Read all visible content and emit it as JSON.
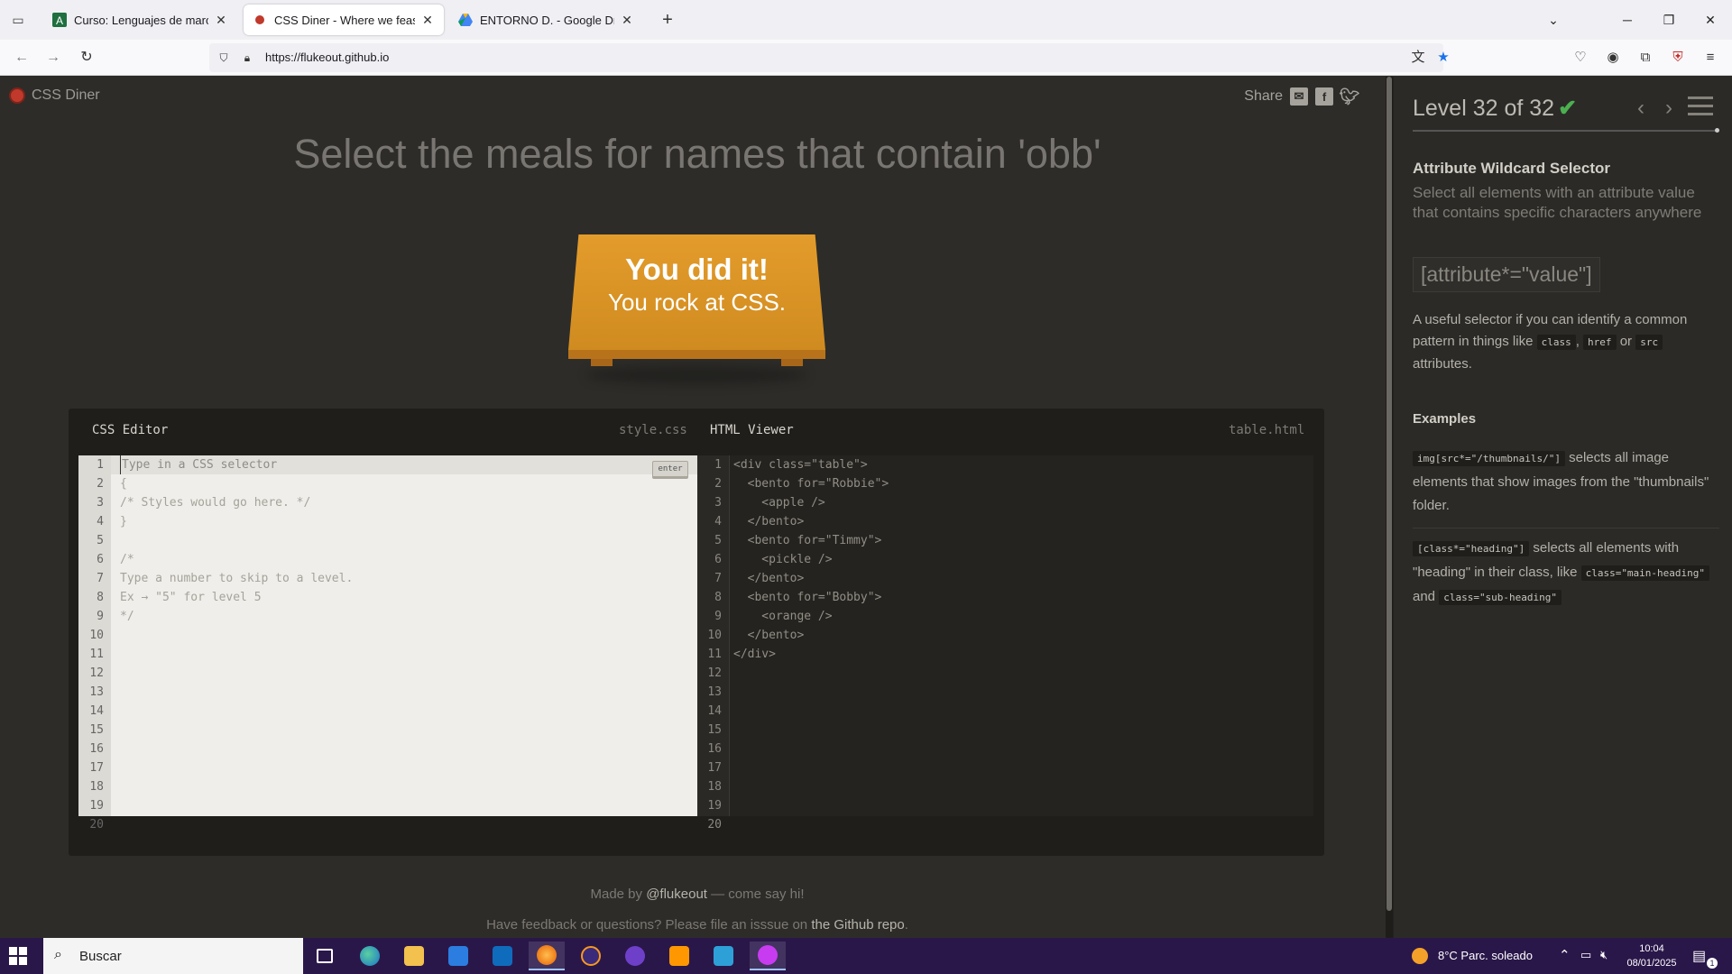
{
  "browser": {
    "tabs": [
      {
        "title": "Curso: Lenguajes de marcas y s",
        "active": false
      },
      {
        "title": "CSS Diner - Where we feast on",
        "active": true
      },
      {
        "title": "ENTORNO D. - Google Drive",
        "active": false
      }
    ],
    "url": "https://flukeout.github.io",
    "bookmark_starred": true
  },
  "page": {
    "logo_text": "CSS Diner",
    "share_label": "Share",
    "order": "Select the meals for names that contain 'obb'",
    "win_line1": "You did it!",
    "win_line2": "You rock at CSS."
  },
  "editor": {
    "css_title": "CSS Editor",
    "css_file": "style.css",
    "html_title": "HTML Viewer",
    "html_file": "table.html",
    "placeholder": "Type in a CSS selector",
    "enter_label": "enter",
    "line_numbers": [
      "1",
      "2",
      "3",
      "4",
      "5",
      "6",
      "7",
      "8",
      "9",
      "10",
      "11",
      "12",
      "13",
      "14",
      "15",
      "16",
      "17",
      "18",
      "19",
      "20"
    ],
    "css_lines": [
      "",
      "{",
      "/* Styles would go here. */",
      "}",
      "",
      "/*",
      "Type a number to skip to a level.",
      "Ex → \"5\" for level 5",
      "*/"
    ],
    "html_lines": [
      "<div class=\"table\">",
      "  <bento for=\"Robbie\">",
      "    <apple />",
      "  </bento>",
      "  <bento for=\"Timmy\">",
      "    <pickle />",
      "  </bento>",
      "  <bento for=\"Bobby\">",
      "    <orange />",
      "  </bento>",
      "</div>"
    ]
  },
  "footer": {
    "made_prefix": "Made by ",
    "made_link": "@flukeout",
    "made_suffix": " — come say hi!",
    "feedback_prefix": "Have feedback or questions? Please file an isssue on ",
    "feedback_link": "the Github repo",
    "feedback_suffix": "."
  },
  "sidebar": {
    "level": "Level 32 of 32",
    "completed": true,
    "selector_name": "Attribute Wildcard Selector",
    "selector_title": "Select all elements with an attribute value that contains specific characters anywhere",
    "syntax": "[attribute*=\"value\"]",
    "hint_before": "A useful selector if you can identify a common pattern in things like ",
    "hint_code1": "class",
    "hint_sep1": ", ",
    "hint_code2": "href",
    "hint_sep2": " or ",
    "hint_code3": "src",
    "hint_after": " attributes.",
    "examples_title": "Examples",
    "example1_code": "img[src*=\"/thumbnails/\"]",
    "example1_text": " selects all image elements that show images from the \"thumbnails\" folder.",
    "example2_code": "[class*=\"heading\"]",
    "example2_text1": " selects all elements with \"heading\" in their class, like ",
    "example2_code2": "class=\"main-heading\"",
    "example2_text2": " and ",
    "example2_code3": "class=\"sub-heading\""
  },
  "taskbar": {
    "search_placeholder": "Buscar",
    "weather": "8°C  Parc. soleado",
    "time": "10:04",
    "date": "08/01/2025",
    "notification_count": "1"
  },
  "colors": {
    "accent_orange": "#e39c2b",
    "check_green": "#4caf50",
    "logo_red": "#c0392b"
  }
}
